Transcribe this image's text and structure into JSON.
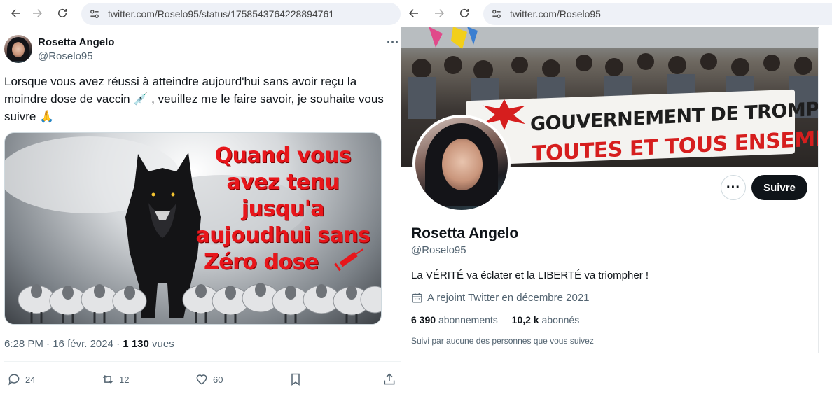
{
  "left": {
    "browser": {
      "url": "twitter.com/Roselo95/status/1758543764228894761"
    },
    "tweet": {
      "author_name": "Rosetta Angelo",
      "author_handle": "@Roselo95",
      "more_label": "···",
      "text_part1": "Lorsque vous avez réussi à atteindre aujourd'hui sans avoir reçu la moindre dose de vaccin ",
      "syringe_emoji": "💉",
      "text_part2": " , veuillez me le faire savoir, je souhaite vous suivre ",
      "hands_emoji": "🙏",
      "image_text": [
        "Quand vous",
        "avez tenu",
        "jusqu'a",
        "aujoudhui sans",
        "Zéro dose"
      ],
      "time": "6:28 PM",
      "sep": "·",
      "date": "16 févr. 2024",
      "views_count": "1 130",
      "views_label": "vues",
      "replies": "24",
      "retweets": "12",
      "likes": "60"
    }
  },
  "right": {
    "browser": {
      "url": "twitter.com/Roselo95"
    },
    "banner": {
      "line1": "GOUVERNEMENT DE TROMPERIE",
      "line2": "TOUTES ET TOUS ENSEMBLE !"
    },
    "profile": {
      "more_label": "···",
      "follow_label": "Suivre",
      "name": "Rosetta Angelo",
      "handle": "@Roselo95",
      "bio": "La VÉRITÉ va éclater et la LIBERTÉ va triompher !",
      "joined": "A rejoint Twitter en décembre 2021",
      "following_count": "6 390",
      "following_label": "abonnements",
      "followers_count": "10,2 k",
      "followers_label": "abonnés",
      "followed_by": "Suivi par aucune des personnes que vous suivez"
    }
  }
}
